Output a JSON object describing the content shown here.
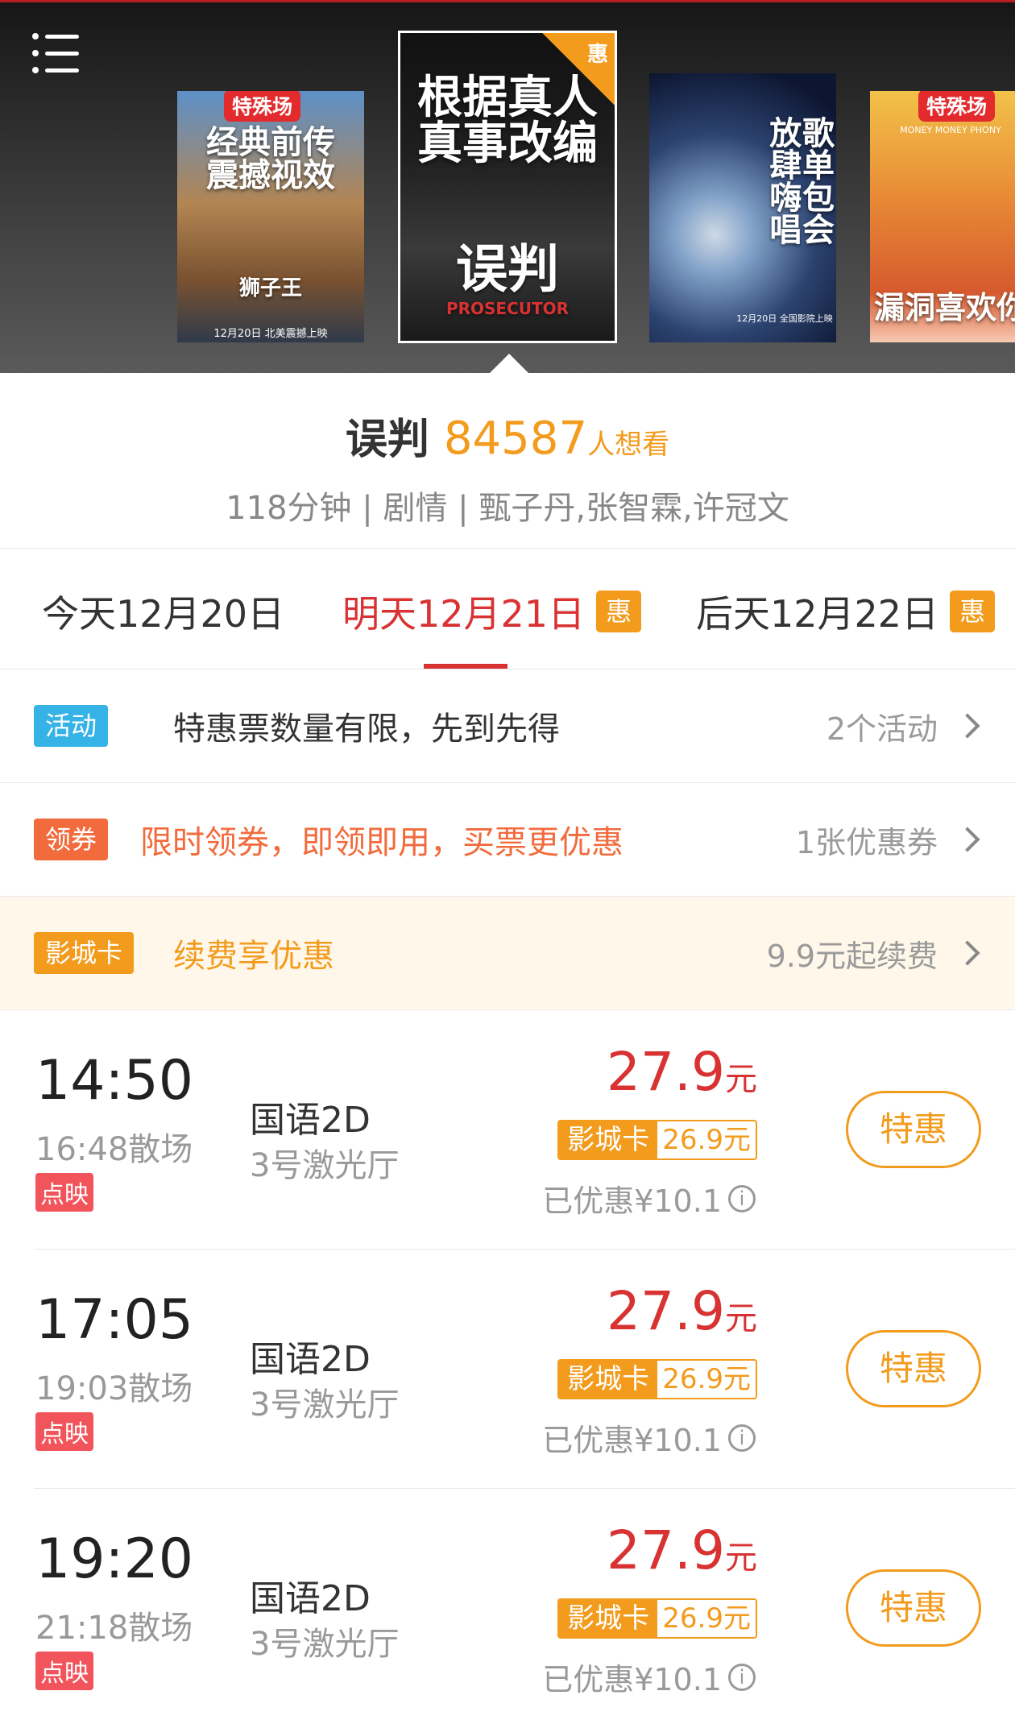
{
  "header": {
    "posters": [
      {
        "tag": "特殊场",
        "big": "经典前传\n震撼视效",
        "title": "狮子王",
        "sub": "12月20日 北美震撼上映"
      },
      {
        "corner": "惠",
        "big": "根据真人\n真事改编",
        "title": "误判",
        "en": "PROSECUTOR"
      },
      {
        "big": "歌单包会\n放肆嗨唱",
        "sub": "12月20日 全国影院上映"
      },
      {
        "tag": "特殊场",
        "big": "漏洞喜欢你",
        "en": "MONEY MONEY PHONY"
      }
    ]
  },
  "movie": {
    "name": "误判",
    "want_count": "84587",
    "want_label": "人想看",
    "meta": "118分钟 | 剧情 | 甄子丹,张智霖,许冠文"
  },
  "dates": [
    {
      "label": "今天12月20日"
    },
    {
      "label": "明天12月21日",
      "badge": "惠"
    },
    {
      "label": "后天12月22日",
      "badge": "惠"
    }
  ],
  "promos": {
    "activity": {
      "badge": "活动",
      "text": "特惠票数量有限，先到先得",
      "right": "2个活动"
    },
    "coupon": {
      "badge": "领券",
      "text": "限时领券，即领即用，买票更优惠",
      "right": "1张优惠券"
    },
    "card": {
      "badge": "影城卡",
      "text": "续费享优惠",
      "right": "9.9元起续费"
    }
  },
  "showtimes": [
    {
      "time": "14:50",
      "end": "16:48散场",
      "tag": "点映",
      "lang": "国语2D",
      "hall": "3号激光厅",
      "price": "27.9",
      "unit": "元",
      "card_label": "影城卡",
      "card_price": "26.9元",
      "discount": "已优惠¥10.1",
      "button": "特惠"
    },
    {
      "time": "17:05",
      "end": "19:03散场",
      "tag": "点映",
      "lang": "国语2D",
      "hall": "3号激光厅",
      "price": "27.9",
      "unit": "元",
      "card_label": "影城卡",
      "card_price": "26.9元",
      "discount": "已优惠¥10.1",
      "button": "特惠"
    },
    {
      "time": "19:20",
      "end": "21:18散场",
      "tag": "点映",
      "lang": "国语2D",
      "hall": "3号激光厅",
      "price": "27.9",
      "unit": "元",
      "card_label": "影城卡",
      "card_price": "26.9元",
      "discount": "已优惠¥10.1",
      "button": "特惠"
    }
  ],
  "colors": {
    "accent": "#d83232",
    "orange": "#f29b1c",
    "blue": "#35b2e6",
    "coupon": "#f26b3c"
  },
  "icons": {
    "menu": "menu-icon",
    "chevron": "chevron-right-icon",
    "info": "info-circle-icon"
  }
}
